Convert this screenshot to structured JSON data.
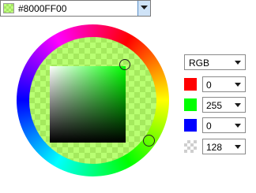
{
  "color_field": {
    "hex_text": "#8000FF00"
  },
  "mode": {
    "selected": "RGB"
  },
  "channels": [
    {
      "value": "0",
      "color": "#ff0000"
    },
    {
      "value": "255",
      "color": "#00ff00"
    },
    {
      "value": "0",
      "color": "#0000ff"
    },
    {
      "value": "128",
      "color": "alpha-checker"
    }
  ],
  "icons": {
    "dropdown": "chevron-down-icon"
  },
  "colors": {
    "current_color": "#00FF00",
    "current_alpha": "#80"
  }
}
